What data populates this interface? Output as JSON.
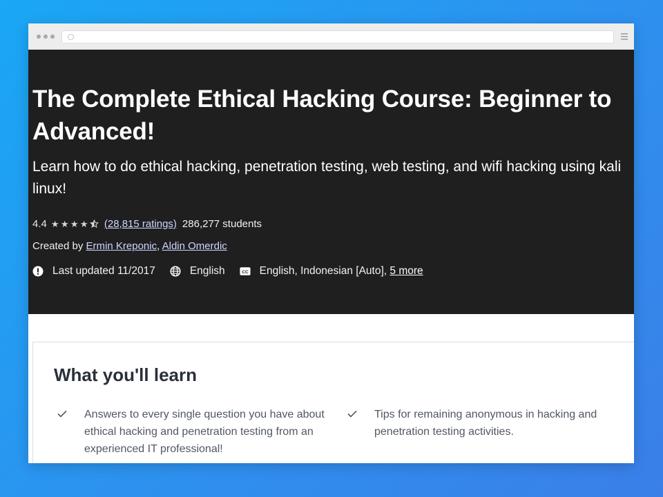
{
  "colors": {
    "background": "#1aa7f5",
    "hero": "#1f1f20",
    "link": "#cfd6ff",
    "heading": "#29303b"
  },
  "browser": {
    "icons": [
      "window-dots",
      "reload-icon",
      "menu-icon"
    ]
  },
  "course": {
    "title": "The Complete Ethical Hacking Course: Beginner to Advanced!",
    "subtitle": "Learn how to do ethical hacking, penetration testing, web testing, and wifi hacking using kali linux!",
    "rating": "4.4",
    "stars_value": 4.5,
    "ratings_count": "(28,815 ratings)",
    "students": "286,277 students",
    "created_by_label": "Created by",
    "authors": [
      "Ermin Kreponic",
      "Aldin Omerdic"
    ],
    "author_separator": ",",
    "last_updated": "Last updated 11/2017",
    "language": "English",
    "captions": "English, Indonesian [Auto],",
    "captions_more": "5 more"
  },
  "learn": {
    "title": "What you'll learn",
    "items": [
      "Answers to every single question you have about ethical hacking and penetration testing from an experienced IT professional!",
      "Tips for remaining anonymous in hacking and penetration testing activities."
    ]
  }
}
